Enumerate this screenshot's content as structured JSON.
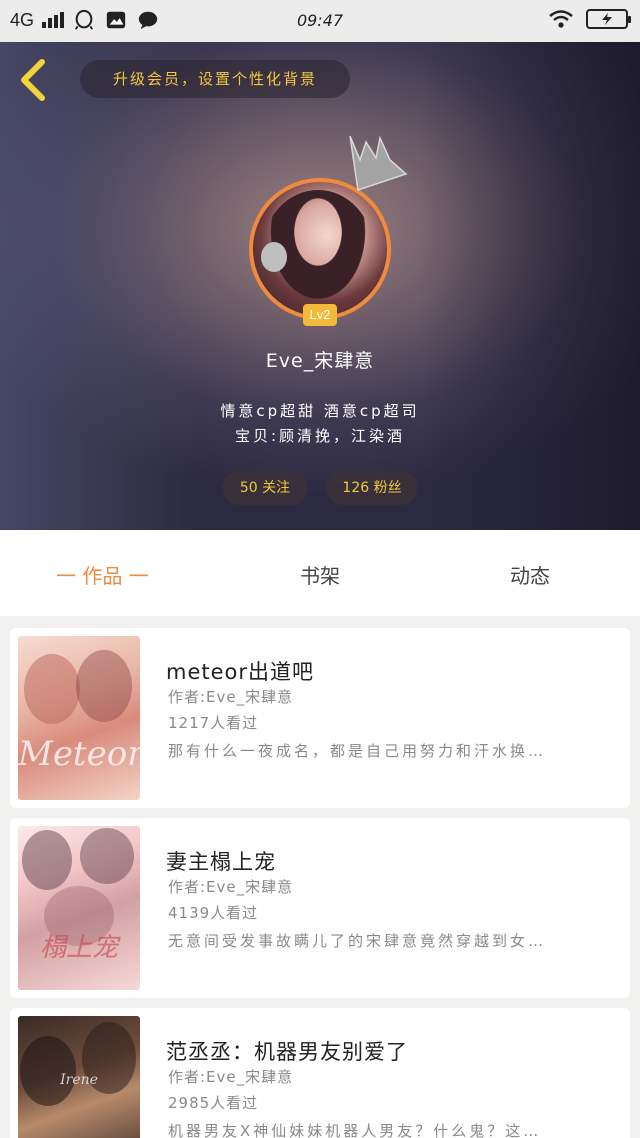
{
  "status_bar": {
    "network": "4G",
    "time": "09:47"
  },
  "header": {
    "banner": "升级会员，设置个性化背景",
    "level": "Lv2",
    "username": "Eve_宋肆意",
    "bio_line1": "情意cp超甜   酒意cp超司",
    "bio_line2": "宝贝:顾清挽，江染酒",
    "follow_label": "50 关注",
    "fans_label": "126 粉丝"
  },
  "tabs": [
    {
      "label": "一 作品 一",
      "active": true
    },
    {
      "label": "书架",
      "active": false
    },
    {
      "label": "动态",
      "active": false
    }
  ],
  "books": [
    {
      "title": "meteor出道吧",
      "author": "作者:Eve_宋肆意",
      "reads": "1217人看过",
      "desc": "那有什么一夜成名，都是自己用努力和汗水换…",
      "cover_text": "Meteor"
    },
    {
      "title": "妻主榻上宠",
      "author": "作者:Eve_宋肆意",
      "reads": "4139人看过",
      "desc": "无意间受发事故瞒儿了的宋肆意竟然穿越到女…",
      "cover_text": "榻上宠"
    },
    {
      "title": "范丞丞：机器男友别爱了",
      "author": "作者:Eve_宋肆意",
      "reads": "2985人看过",
      "desc": "机器男友X神仙妹妹机器人男友？什么鬼？这…",
      "cover_text": "Irene"
    }
  ],
  "colors": {
    "accent_orange": "#ef8a3f",
    "gold": "#f3c63b",
    "level_badge": "#f3b93a"
  }
}
